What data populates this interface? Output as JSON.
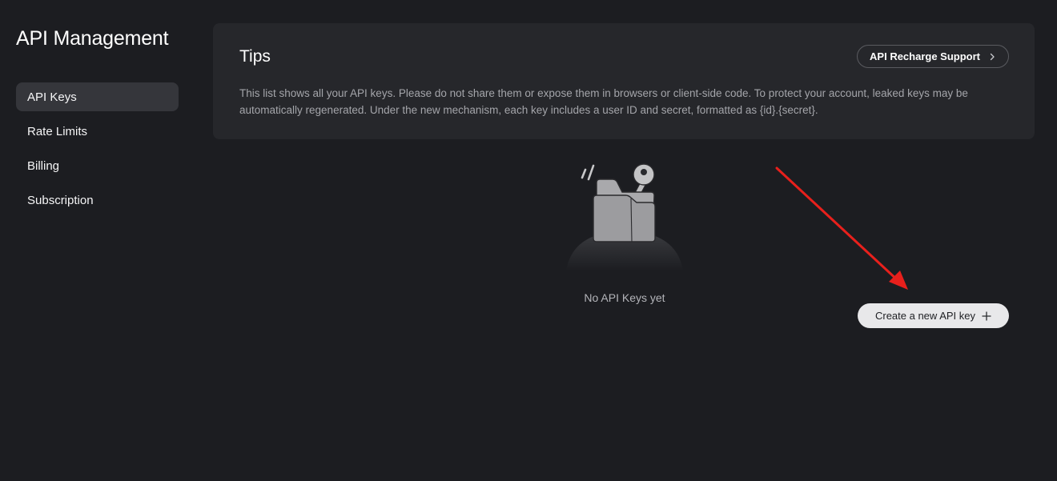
{
  "sidebar": {
    "title": "API Management",
    "items": [
      {
        "label": "API Keys",
        "active": true
      },
      {
        "label": "Rate Limits",
        "active": false
      },
      {
        "label": "Billing",
        "active": false
      },
      {
        "label": "Subscription",
        "active": false
      }
    ]
  },
  "tips": {
    "title": "Tips",
    "recharge_label": "API Recharge Support",
    "body": "This list shows all your API keys. Please do not share them or expose them in browsers or client-side code. To protect your account, leaked keys may be automatically regenerated. Under the new mechanism, each key includes a user ID and secret, formatted as {id}.{secret}."
  },
  "empty_state": {
    "message": "No API Keys yet",
    "icon": "folder-key-icon"
  },
  "actions": {
    "create_label": "Create a new API key"
  },
  "colors": {
    "background": "#1c1d21",
    "card": "#26272b",
    "active_nav": "#35363b",
    "create_button": "#e8e8ea",
    "annotation": "#e8201c"
  }
}
